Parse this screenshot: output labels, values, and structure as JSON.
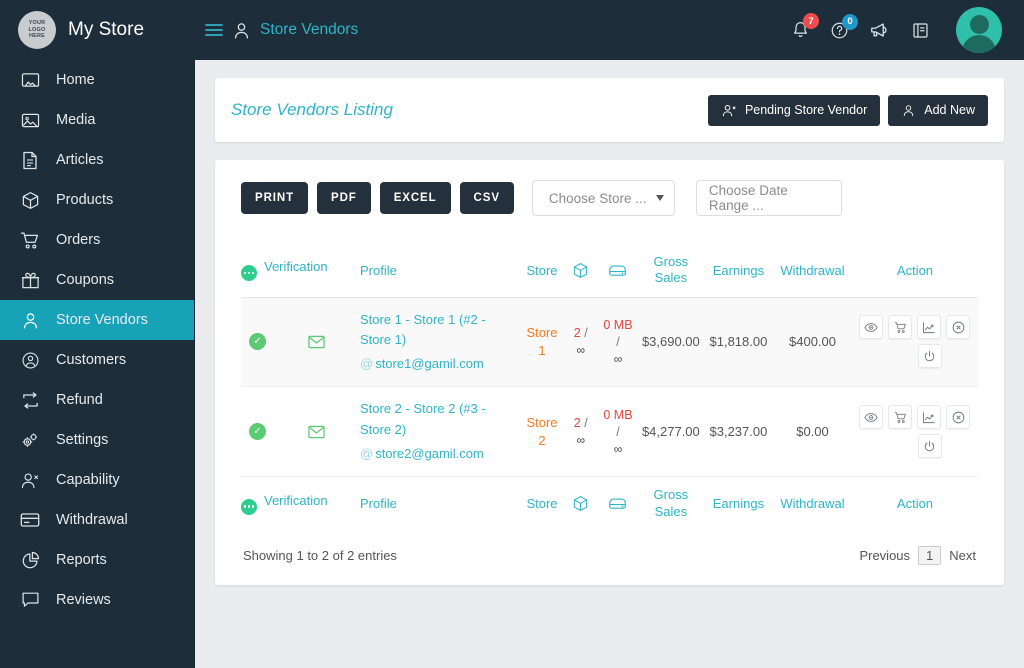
{
  "topbar": {
    "logo_lines": [
      "YOUR",
      "LOGO",
      "HERE"
    ],
    "brand_name": "My Store",
    "breadcrumb_title": "Store Vendors",
    "menu_icon": "hamburger-icon",
    "breadcrumb_icon": "user-icon",
    "notifications_badge": "7",
    "help_badge": "0",
    "icons": [
      "bell-icon",
      "help-circle-icon",
      "megaphone-icon",
      "book-icon",
      "avatar"
    ],
    "accent_color": "#2fb4c8",
    "bar_color": "#1d2d3a"
  },
  "sidebar": {
    "active": "Store Vendors",
    "active_color": "#17a2b8",
    "items": [
      {
        "label": "Home",
        "icon": "home-icon"
      },
      {
        "label": "Media",
        "icon": "image-icon"
      },
      {
        "label": "Articles",
        "icon": "file-text-icon"
      },
      {
        "label": "Products",
        "icon": "box-icon"
      },
      {
        "label": "Orders",
        "icon": "cart-icon"
      },
      {
        "label": "Coupons",
        "icon": "gift-icon"
      },
      {
        "label": "Store Vendors",
        "icon": "user-icon"
      },
      {
        "label": "Customers",
        "icon": "user-circle-icon"
      },
      {
        "label": "Refund",
        "icon": "refund-arrows-icon"
      },
      {
        "label": "Settings",
        "icon": "gears-icon"
      },
      {
        "label": "Capability",
        "icon": "user-x-icon"
      },
      {
        "label": "Withdrawal",
        "icon": "credit-card-icon"
      },
      {
        "label": "Reports",
        "icon": "pie-chart-icon"
      },
      {
        "label": "Reviews",
        "icon": "comment-icon"
      }
    ]
  },
  "page": {
    "title": "Store Vendors Listing",
    "pending_button": {
      "label": "Pending Store Vendor",
      "icon": "user-x-icon"
    },
    "add_button": {
      "label": "Add New",
      "icon": "user-icon"
    }
  },
  "toolbar": {
    "export_buttons": [
      "PRINT",
      "PDF",
      "EXCEL",
      "CSV"
    ],
    "store_select": {
      "placeholder": "Choose Store ...",
      "value": "",
      "icon": "caret-down-icon"
    },
    "date_range": {
      "placeholder": "Choose Date Range ...",
      "value": ""
    }
  },
  "table": {
    "headers": {
      "status_icon": "green-dots-icon",
      "verification": "Verification",
      "profile": "Profile",
      "store": "Store",
      "products_icon": "box-icon",
      "disk_icon": "disk-icon",
      "gross_sales": "Gross Sales",
      "earnings": "Earnings",
      "withdrawal": "Withdrawal",
      "action": "Action"
    },
    "rows": [
      {
        "verified_icon": "check-circle-icon",
        "mail_icon": "envelope-icon",
        "profile_name": "Store 1 - Store 1 (#2 - Store 1)",
        "email": "store1@gamil.com",
        "store": "Store 1",
        "products_used": "2",
        "products_limit": "∞",
        "disk_used": "0 MB",
        "disk_limit": "∞",
        "gross_sales": "$3,690.00",
        "earnings": "$1,818.00",
        "withdrawal": "$400.00",
        "actions": [
          "eye-icon",
          "cart-icon",
          "chart-icon",
          "x-circle-icon",
          "power-icon"
        ]
      },
      {
        "verified_icon": "check-circle-icon",
        "mail_icon": "envelope-icon",
        "profile_name": "Store 2 - Store 2 (#3 - Store 2)",
        "email": "store2@gamil.com",
        "store": "Store 2",
        "products_used": "2",
        "products_limit": "∞",
        "disk_used": "0 MB",
        "disk_limit": "∞",
        "gross_sales": "$4,277.00",
        "earnings": "$3,237.00",
        "withdrawal": "$0.00",
        "actions": [
          "eye-icon",
          "cart-icon",
          "chart-icon",
          "x-circle-icon",
          "power-icon"
        ]
      }
    ],
    "footer": {
      "entries": "Showing 1 to 2 of 2 entries",
      "previous": "Previous",
      "current_page": "1",
      "next": "Next"
    }
  }
}
